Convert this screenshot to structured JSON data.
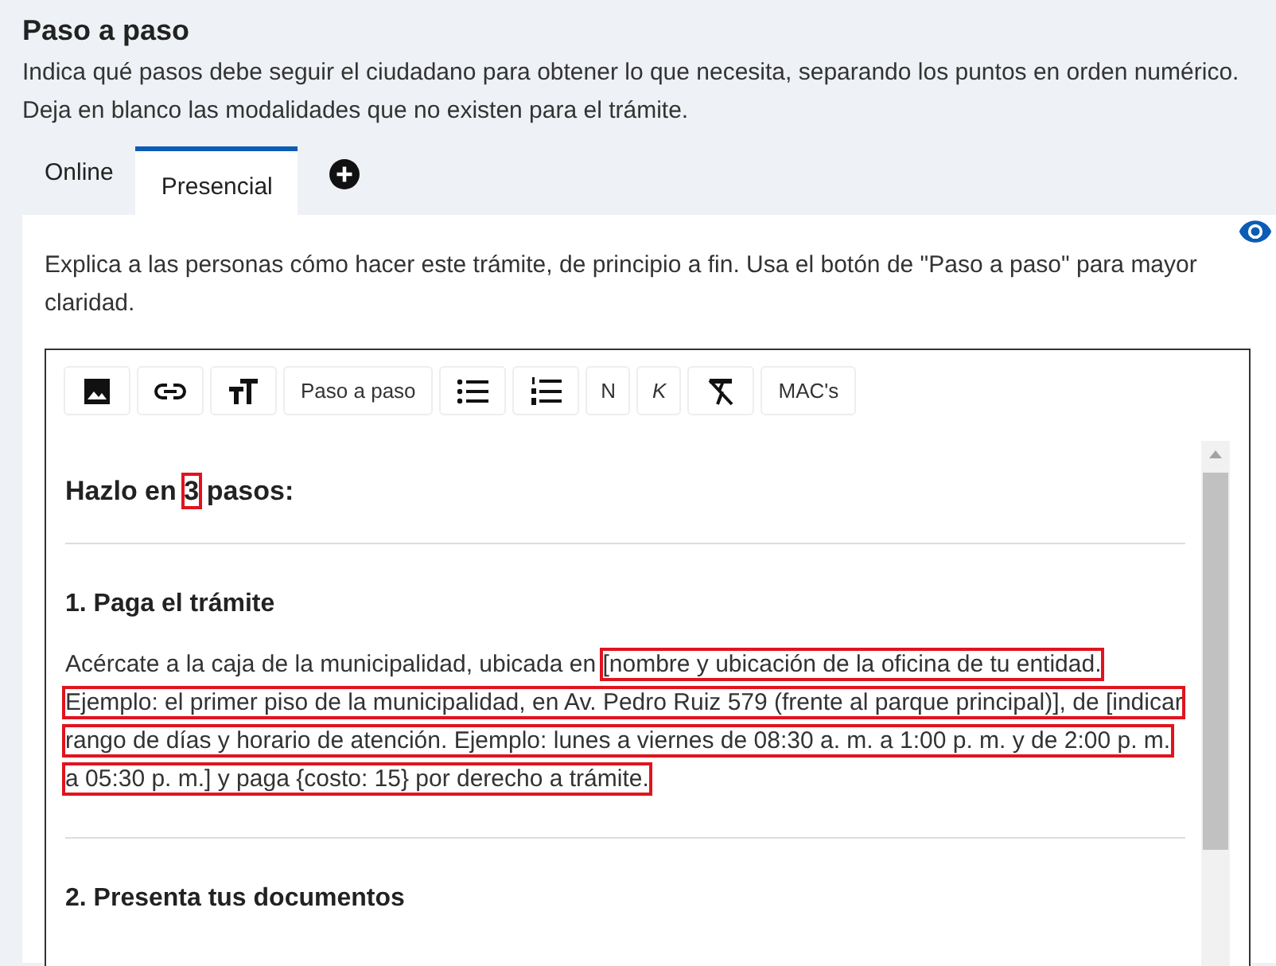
{
  "header": {
    "title": "Paso a paso",
    "description": [
      "Indica qué pasos debe seguir el ciudadano para obtener lo que necesita, separando los puntos en orden numérico.",
      "Deja en blanco las modalidades que no existen para el trámite."
    ]
  },
  "tabs": [
    {
      "label": "Online",
      "selected": false
    },
    {
      "label": "Presencial",
      "selected": true
    }
  ],
  "panel": {
    "instruction": "Explica a las personas cómo hacer este trámite, de principio a fin. Usa el botón de \"Paso a paso\" para mayor claridad."
  },
  "toolbar": [
    {
      "kind": "image"
    },
    {
      "kind": "link"
    },
    {
      "kind": "textsize"
    },
    {
      "kind": "label",
      "label": "Paso a paso"
    },
    {
      "kind": "bullets"
    },
    {
      "kind": "numbers"
    },
    {
      "kind": "bold",
      "label": "N"
    },
    {
      "kind": "italic",
      "label": "K"
    },
    {
      "kind": "clearformat"
    },
    {
      "kind": "label",
      "label": "MAC's"
    }
  ],
  "content": [
    {
      "kind": "heading",
      "segments": [
        {
          "text": "Hazlo en ",
          "highlighted": false
        },
        {
          "text": "3",
          "highlighted": true
        },
        {
          "text": " pasos:",
          "highlighted": false
        }
      ]
    },
    {
      "kind": "divider"
    },
    {
      "kind": "subheading",
      "text": "1. Paga el trámite"
    },
    {
      "kind": "paragraph",
      "segments": [
        {
          "text": "Acércate a la caja de la municipalidad, ubicada en ",
          "highlighted": false
        },
        {
          "text": "[nombre y ubicación de la oficina de tu entidad. Ejemplo: el primer piso de la municipalidad, en Av. Pedro Ruiz 579 (frente al parque principal)], de [indicar rango de días y horario de atención. Ejemplo: lunes a viernes de 08:30 a. m. a 1:00 p. m. y de 2:00 p. m. a 05:30 p. m.] y paga {costo: 15} por derecho a trámite.",
          "highlighted": true
        }
      ]
    },
    {
      "kind": "divider"
    },
    {
      "kind": "subheading",
      "text": "2. Presenta tus documentos"
    }
  ]
}
